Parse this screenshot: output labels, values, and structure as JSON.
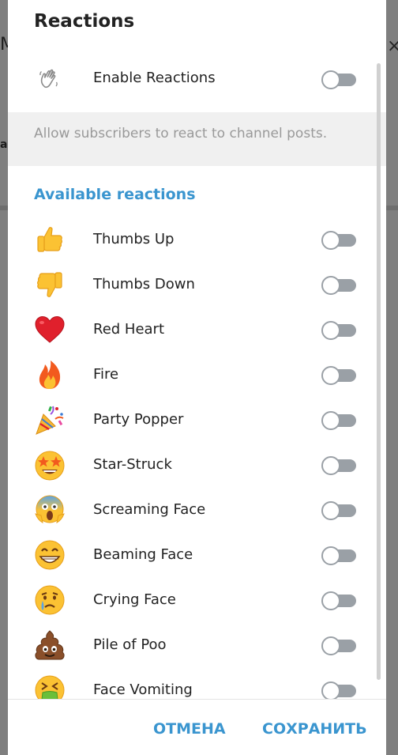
{
  "background": {
    "left_letter": "M",
    "left_small": "a"
  },
  "dialog": {
    "title": "Reactions",
    "enable": {
      "label": "Enable Reactions",
      "icon": "waving-hand-icon",
      "enabled": false
    },
    "info": "Allow subscribers to react to channel posts.",
    "section_header": "Available reactions",
    "reactions": [
      {
        "label": "Thumbs Up",
        "icon": "thumbs-up-icon",
        "enabled": false
      },
      {
        "label": "Thumbs Down",
        "icon": "thumbs-down-icon",
        "enabled": false
      },
      {
        "label": "Red Heart",
        "icon": "red-heart-icon",
        "enabled": false
      },
      {
        "label": "Fire",
        "icon": "fire-icon",
        "enabled": false
      },
      {
        "label": "Party Popper",
        "icon": "party-popper-icon",
        "enabled": false
      },
      {
        "label": "Star-Struck",
        "icon": "star-struck-icon",
        "enabled": false
      },
      {
        "label": "Screaming Face",
        "icon": "screaming-face-icon",
        "enabled": false
      },
      {
        "label": "Beaming Face",
        "icon": "beaming-face-icon",
        "enabled": false
      },
      {
        "label": "Crying Face",
        "icon": "crying-face-icon",
        "enabled": false
      },
      {
        "label": "Pile of Poo",
        "icon": "pile-of-poo-icon",
        "enabled": false
      },
      {
        "label": "Face Vomiting",
        "icon": "face-vomiting-icon",
        "enabled": false
      }
    ],
    "buttons": {
      "cancel": "ОТМЕНА",
      "save": "СОХРАНИТЬ"
    }
  },
  "colors": {
    "accent": "#3a95cf",
    "toggle_off": "#9aa0a6",
    "info_bg": "#f0f0f0"
  }
}
